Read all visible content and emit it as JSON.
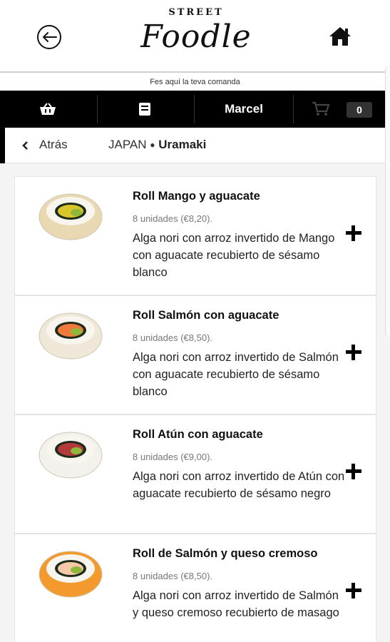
{
  "header": {
    "logo_street": "STREET",
    "logo_name": "Foodle",
    "tagline": "Fes aquí la teva comanda"
  },
  "nav": {
    "user": "Marcel",
    "cart_count": "0",
    "icons": [
      "basket-icon",
      "menu-book-icon",
      "cart-icon"
    ]
  },
  "breadcrumb": {
    "back_label": "Atrás",
    "category": "JAPAN",
    "separator": "●",
    "subcategory": "Uramaki"
  },
  "products": [
    {
      "name": "Roll Mango y aguacate",
      "units": "8 unidades (€8,20).",
      "desc": "Alga nori con arroz invertido de Mango con aguacate recubierto de sésamo blanco",
      "coating": "#e8d9b3",
      "filling": "#d9c62d"
    },
    {
      "name": "Roll Salmón con aguacate",
      "units": "8 unidades (€8,50).",
      "desc": "Alga nori con arroz invertido de Salmón con aguacate recubierto de sésamo blanco",
      "coating": "#efe8d8",
      "filling": "#f07a3c"
    },
    {
      "name": "Roll Atún con aguacate",
      "units": "8 unidades (€9,00).",
      "desc": "Alga nori con arroz invertido de Atún con aguacate recubierto de sésamo negro",
      "coating": "#f3f1ec",
      "filling": "#b23a3a"
    },
    {
      "name": "Roll de Salmón y queso cremoso",
      "units": "8 unidades (€8,50).",
      "desc": "Alga nori con arroz invertido de Salmón y queso cremoso recubierto de masago",
      "coating": "#f29a2e",
      "filling": "#f5c9a8"
    }
  ]
}
